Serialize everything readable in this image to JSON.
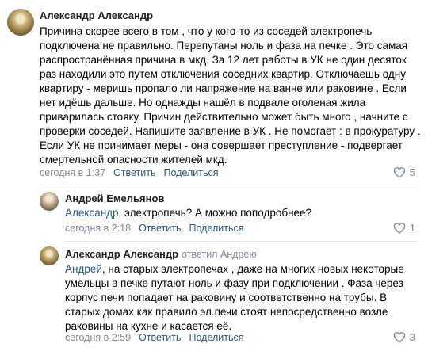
{
  "comments": [
    {
      "author": "Александр Александр",
      "replied_to": "",
      "mention": "",
      "lines": [
        "Причина скорее всего в том , что у кого-то из соседей электропечь",
        "подключена не правильно. Перепутаны ноль и фаза на печке . Это самая",
        "распространённая причина в мкд. За 12 лет работы в УК не один десяток",
        "раз находили это путем отключения соседних квартир. Отключаешь одну",
        "квартиру - меришь пропало ли напряжение на ванне или раковине . Если",
        "нет идёшь дальше. Но однажды нашёл в подвале оголеная жила",
        "приварилась стояку. Причин действительно может быть много , начните с",
        "проверки соседей. Напишите заявление в УК . Не помогает : в прокуратуру .",
        "Если УК не принимает меры - она совершает преступление - подвергает",
        "смертельной опасности жителей мкд."
      ],
      "date": "сегодня в 1:37",
      "reply_label": "Ответить",
      "share_label": "Поделиться",
      "likes": "5"
    },
    {
      "author": "Андрей Емельянов",
      "replied_to": "",
      "mention": "Александр",
      "lines": [
        ", электропечь? А можно поподробнее?"
      ],
      "date": "сегодня в 2:18",
      "reply_label": "Ответить",
      "share_label": "Поделиться",
      "likes": "1"
    },
    {
      "author": "Александр Александр",
      "replied_to": "ответил Андрею",
      "mention": "Андрей",
      "lines": [
        ", на старых электропечах , даже на многих новых некоторые",
        "умельцы в печке путают ноль и фазу при подключении . Фаза через",
        "корпус печи попадает на раковину и соответственно на трубы. В",
        "старых домах как правило эл.печи стоят непосредственно возле",
        "раковины на кухне и касается её."
      ],
      "date": "сегодня в 2:59",
      "reply_label": "Ответить",
      "share_label": "Поделиться",
      "likes": "3"
    }
  ],
  "icons": {
    "share": "share-icon",
    "like": "heart-icon"
  },
  "colors": {
    "link": "#2a5885",
    "meta": "#818c99",
    "divider": "#e7e8ec"
  }
}
